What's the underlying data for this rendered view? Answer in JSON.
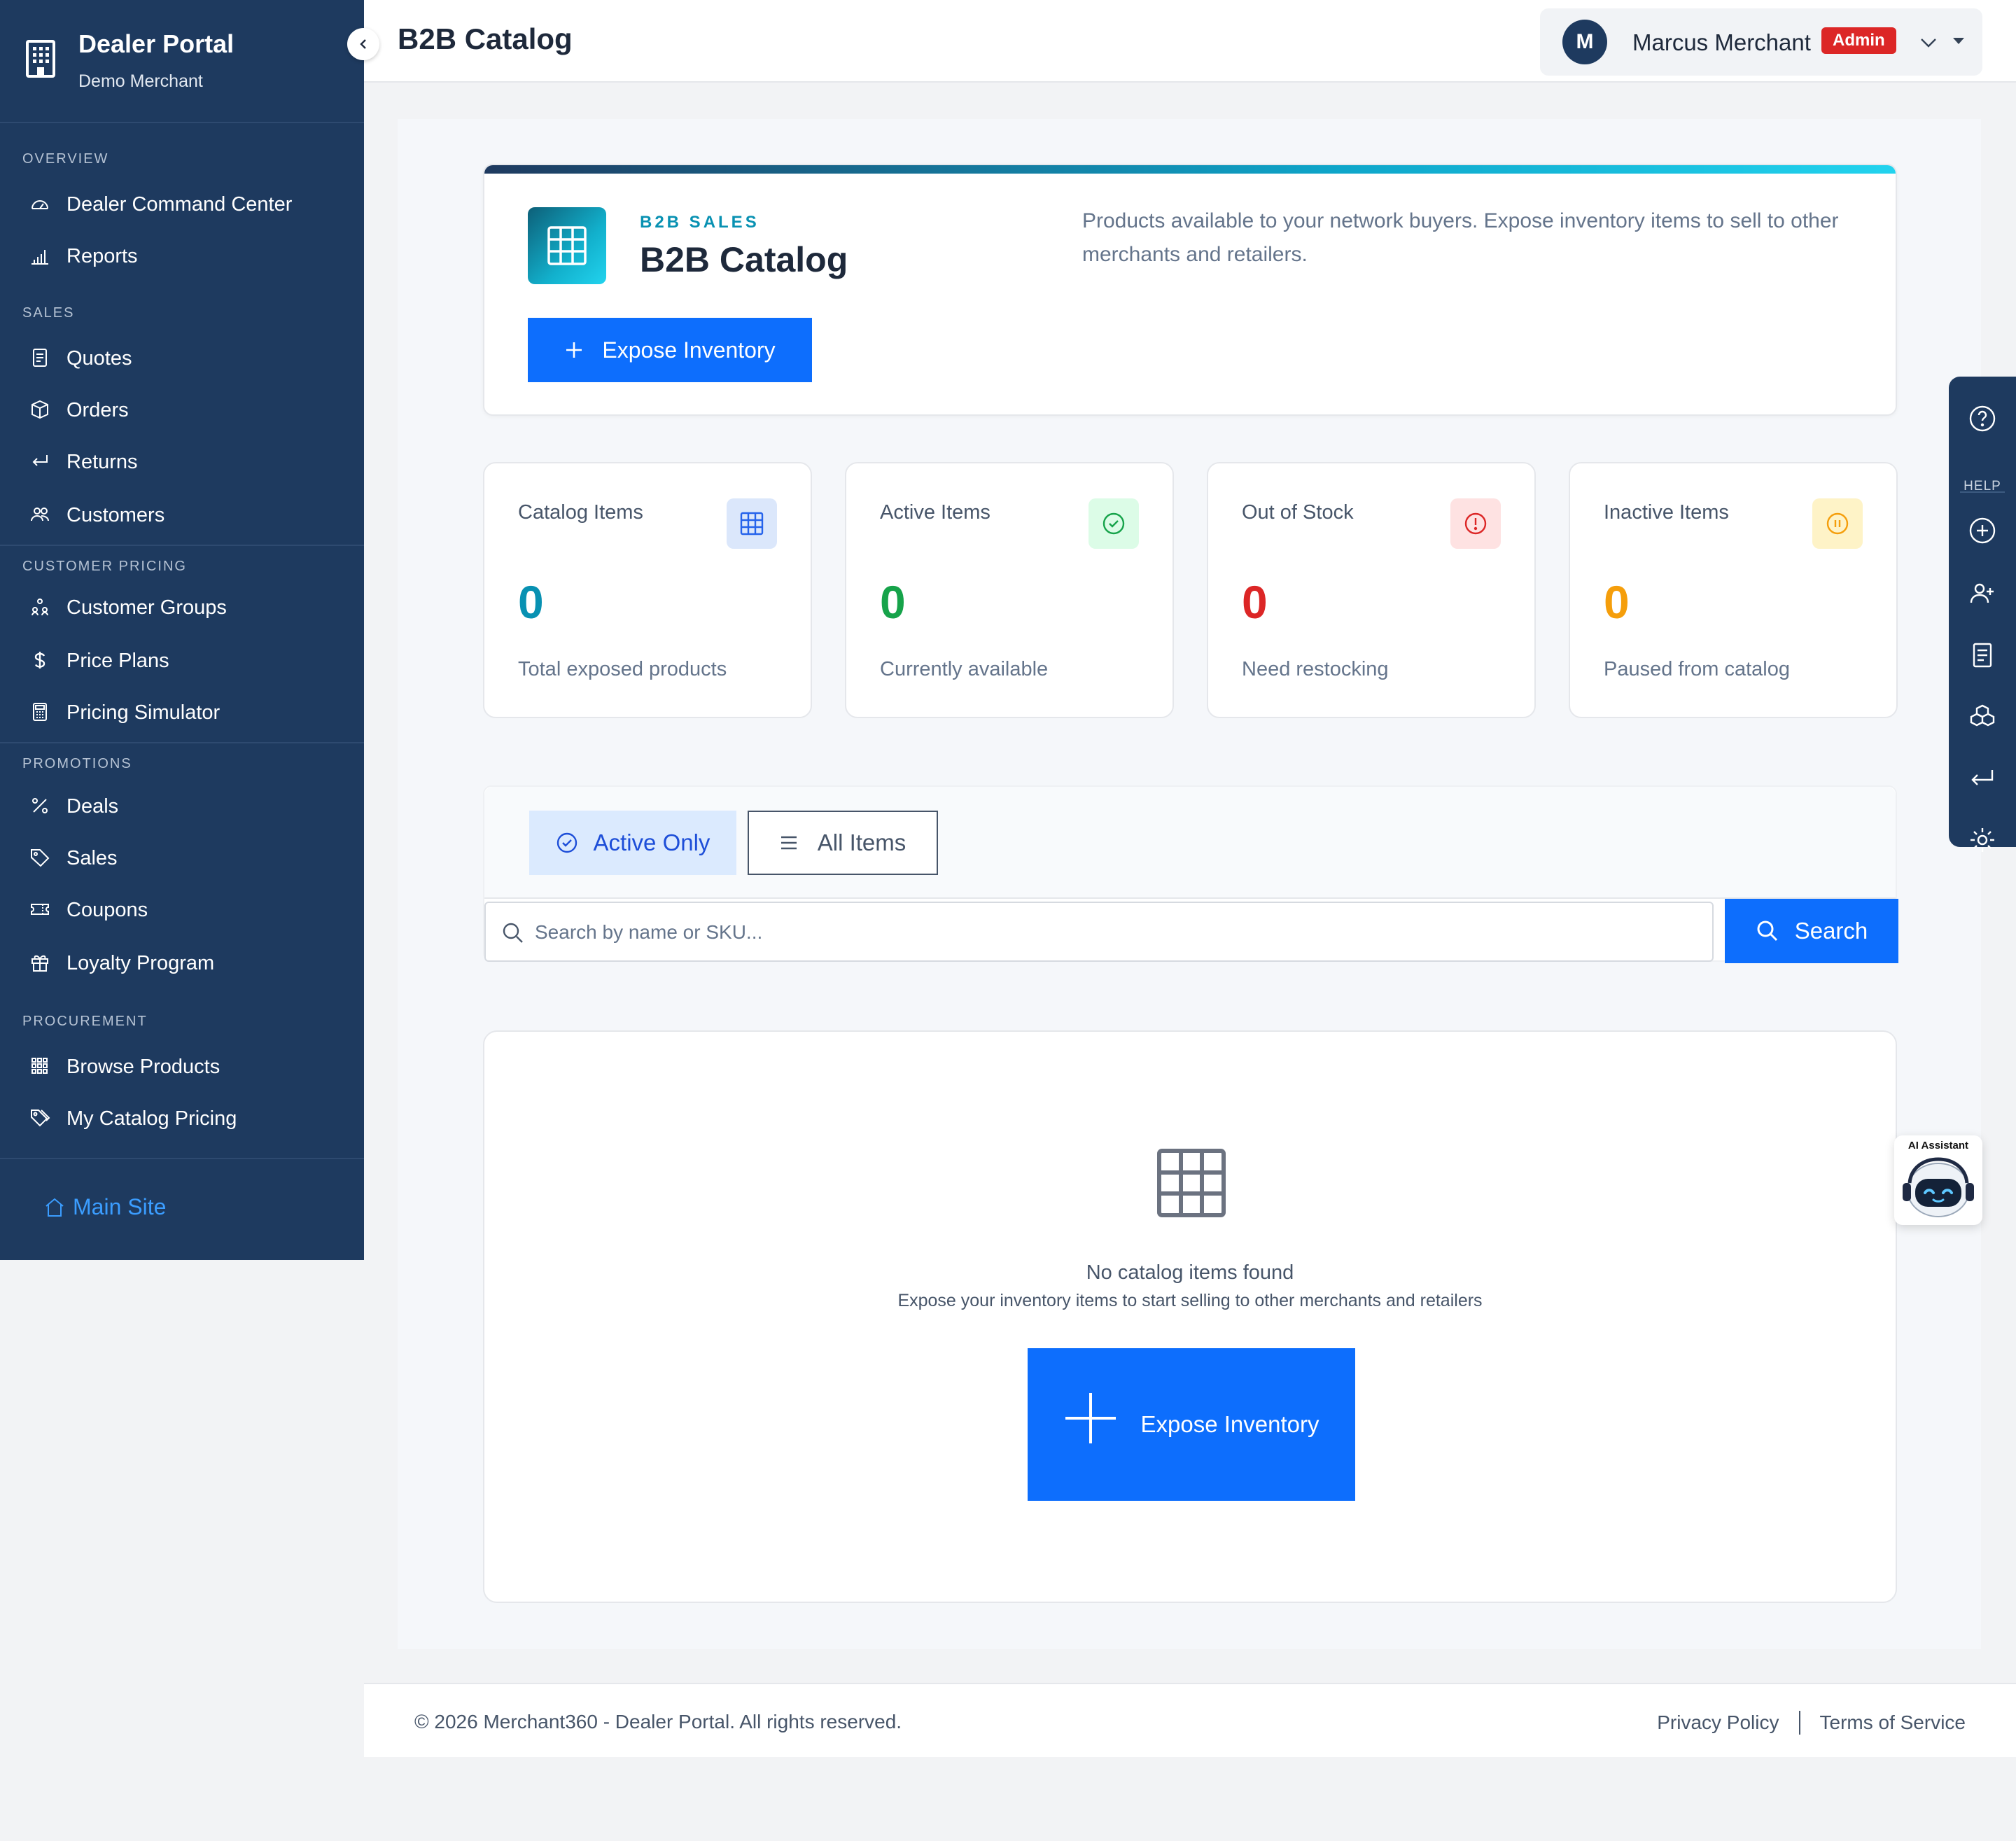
{
  "sidebar": {
    "title": "Dealer Portal",
    "subtitle": "Demo Merchant",
    "sections": {
      "overview": "OVERVIEW",
      "sales": "SALES",
      "customer_pricing": "CUSTOMER PRICING",
      "promotions": "PROMOTIONS",
      "procurement": "PROCUREMENT"
    },
    "items": {
      "dealer_command_center": "Dealer Command Center",
      "reports": "Reports",
      "quotes": "Quotes",
      "orders": "Orders",
      "returns": "Returns",
      "customers": "Customers",
      "customer_groups": "Customer Groups",
      "price_plans": "Price Plans",
      "pricing_simulator": "Pricing Simulator",
      "deals": "Deals",
      "sales": "Sales",
      "coupons": "Coupons",
      "loyalty_program": "Loyalty Program",
      "browse_products": "Browse Products",
      "my_catalog_pricing": "My Catalog Pricing"
    },
    "main_site": "Main Site"
  },
  "topbar": {
    "title": "B2B Catalog",
    "user": {
      "initial": "M",
      "name": "Marcus Merchant",
      "role": "Admin"
    }
  },
  "header": {
    "eyebrow": "B2B SALES",
    "title": "B2B Catalog",
    "description": "Products available to your network buyers. Expose inventory items to sell to other merchants and retailers.",
    "button": "Expose Inventory"
  },
  "stats": [
    {
      "label": "Catalog Items",
      "value": "0",
      "sub": "Total exposed products",
      "color": "#0891b2",
      "icon": "grid-icon"
    },
    {
      "label": "Active Items",
      "value": "0",
      "sub": "Currently available",
      "color": "#16a34a",
      "icon": "check-circle-icon"
    },
    {
      "label": "Out of Stock",
      "value": "0",
      "sub": "Need restocking",
      "color": "#dc2626",
      "icon": "alert-circle-icon"
    },
    {
      "label": "Inactive Items",
      "value": "0",
      "sub": "Paused from catalog",
      "color": "#f59e0b",
      "icon": "pause-circle-icon"
    }
  ],
  "filters": {
    "active_only": "Active Only",
    "all_items": "All Items",
    "search_placeholder": "Search by name or SKU...",
    "search_button": "Search"
  },
  "empty": {
    "title": "No catalog items found",
    "subtitle": "Expose your inventory items to start selling to other merchants and retailers",
    "button": "Expose Inventory"
  },
  "footer": {
    "copyright": "© 2026 Merchant360 - Dealer Portal. All rights reserved.",
    "privacy": "Privacy Policy",
    "terms": "Terms of Service"
  },
  "right_rail": {
    "help": "HELP"
  },
  "ai_widget": {
    "label": "AI Assistant"
  },
  "colors": {
    "sidebar_bg": "#1e3a5f",
    "primary": "#0d6efd",
    "accent_teal": "#0891b2",
    "admin_badge": "#dc2626"
  }
}
